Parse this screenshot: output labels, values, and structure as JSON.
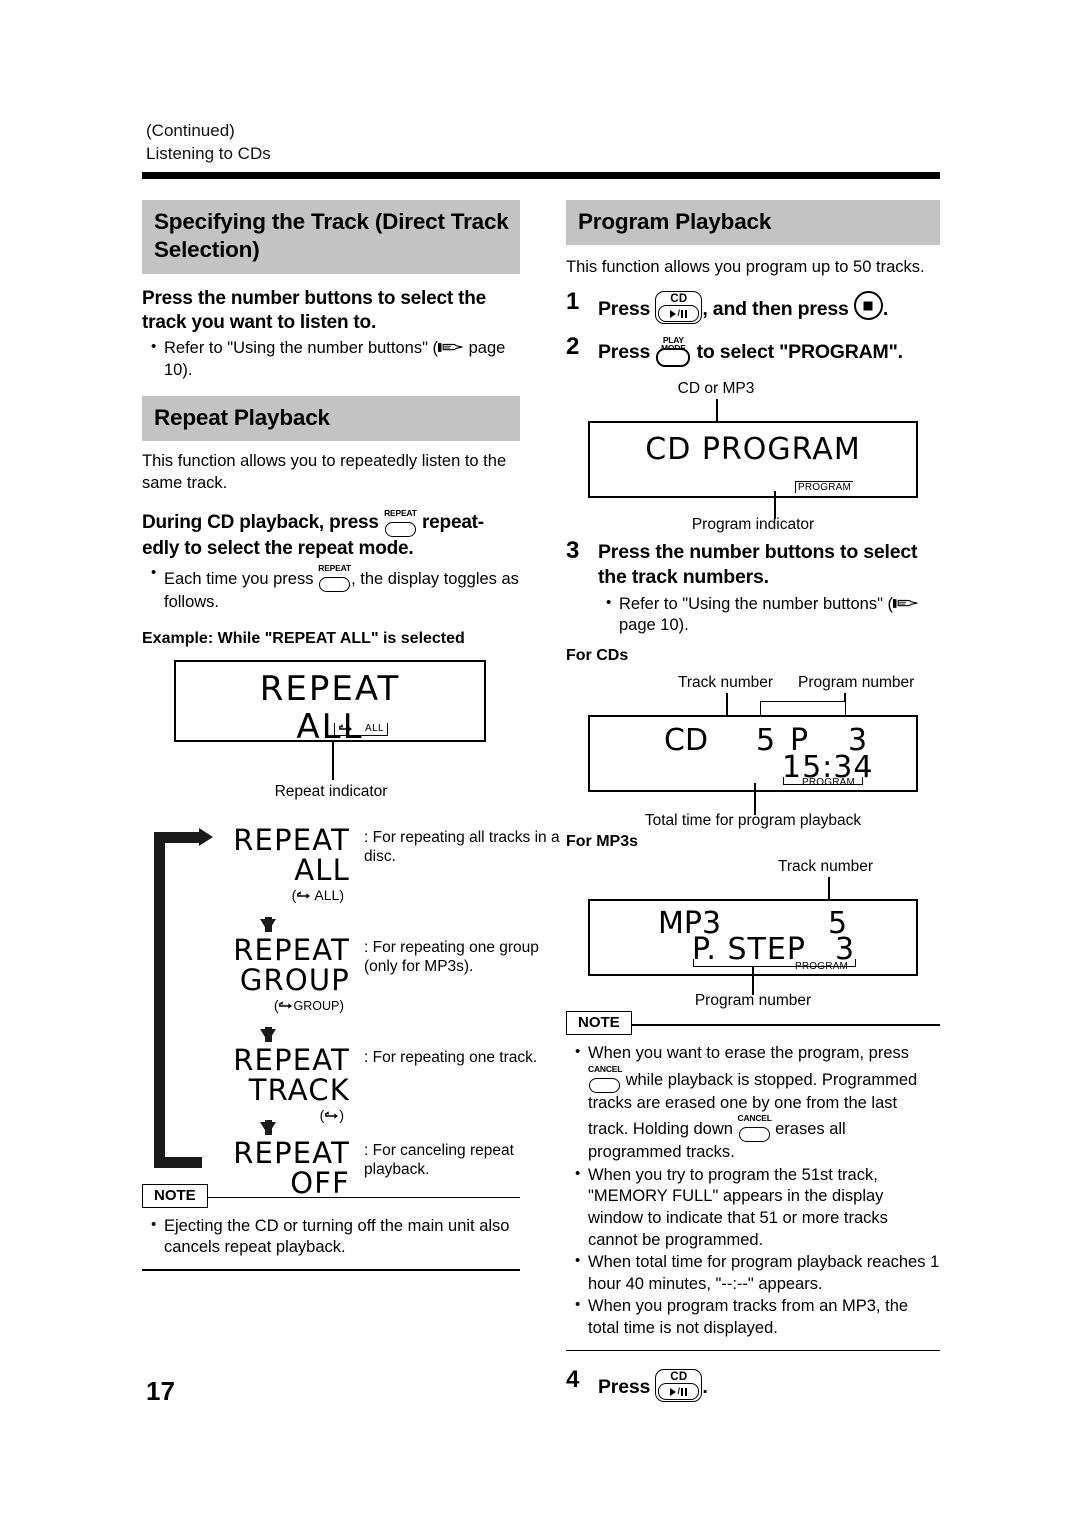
{
  "header": {
    "continued": "(Continued)",
    "running_title": "Listening to CDs"
  },
  "folio": "17",
  "left_column": {
    "section1": {
      "title": "Specifying the Track (Direct Track Selection)",
      "instruction": "Press the number buttons to select the track you want to listen to.",
      "bullets": [
        {
          "pre": "Refer to \"Using the number buttons\" (",
          "icon": "hand-pointer-icon",
          "post": " page 10)."
        }
      ]
    },
    "section2": {
      "title": "Repeat Playback",
      "intro": "This function allows you to repeatedly listen to the same track.",
      "instruction_pre": "During CD playback, press",
      "instruction_button": "REPEAT",
      "instruction_post": "repeat-edly to select the repeat mode.",
      "bullet_pre": "Each time you press",
      "bullet_button": "REPEAT",
      "bullet_post": ", the display toggles as follows.",
      "example_heading": "Example: While \"REPEAT ALL\" is selected",
      "display": {
        "line1": "REPEAT",
        "line2": "ALL",
        "indicator_all": "ALL",
        "indicator_repeat_icon": "repeat-loop-icon"
      },
      "display_caption": "Repeat indicator",
      "flow": [
        {
          "line1": "REPEAT",
          "line2": "ALL",
          "indicator": "( ↺  ALL )",
          "indicator_label": "ALL",
          "desc": ": For repeating all tracks in a disc."
        },
        {
          "line1": "REPEAT",
          "line2": "GROUP",
          "indicator": "( ↺ GROUP )",
          "indicator_label": "GROUP",
          "desc": ": For repeating one group (only for MP3s)."
        },
        {
          "line1": "REPEAT",
          "line2": "TRACK",
          "indicator": "( ↺ )",
          "indicator_label": "",
          "desc": ": For repeating one track."
        },
        {
          "line1": "REPEAT",
          "line2": "OFF",
          "indicator": "",
          "indicator_label": "",
          "desc": ": For canceling repeat playback."
        }
      ],
      "note": {
        "label": "NOTE",
        "items": [
          "Ejecting the CD or turning off the main unit also cancels repeat playback."
        ]
      }
    }
  },
  "right_column": {
    "section": {
      "title": "Program Playback",
      "intro": "This function allows you program up to 50 tracks.",
      "steps": [
        {
          "num": "1",
          "pre": "Press",
          "button1": {
            "top": "CD",
            "glyph": "play-pause-icon"
          },
          "mid": ", and then press",
          "button2": {
            "glyph": "stop-icon"
          },
          "post": "."
        },
        {
          "num": "2",
          "pre": "Press",
          "button1": {
            "top_line1": "PLAY",
            "top_line2": "MODE",
            "glyph": "oval-button-icon"
          },
          "post": "to select \"PROGRAM\"."
        },
        {
          "num": "3",
          "text": "Press the number buttons to select the track numbers.",
          "bullet_pre": "Refer to \"Using the number buttons\" (",
          "bullet_icon": "hand-pointer-icon",
          "bullet_post": " page 10)."
        },
        {
          "num": "4",
          "pre": "Press",
          "button1": {
            "top": "CD",
            "glyph": "play-pause-icon"
          },
          "post": "."
        }
      ],
      "display_program": {
        "top_caption": "CD or MP3",
        "text": "CD  PROGRAM",
        "indicator": "PROGRAM",
        "bottom_caption": "Program indicator"
      },
      "for_cds_heading": "For CDs",
      "display_cd": {
        "caption_track": "Track number",
        "caption_program": "Program number",
        "line1_left": "CD",
        "line1_track": "5",
        "line1_p": "P",
        "line1_prog": "3",
        "line2": "15:34",
        "indicator": "PROGRAM",
        "bottom_caption": "Total time for program playback"
      },
      "for_mp3s_heading": "For MP3s",
      "display_mp3": {
        "caption_track": "Track number",
        "line1_left": "MP3",
        "line1_track": "5",
        "line2_left": "P. STEP",
        "line2_prog": "3",
        "indicator": "PROGRAM",
        "bottom_caption": "Program number"
      },
      "note": {
        "label": "NOTE",
        "item1_pre": "When you want to erase the program, press",
        "item1_button": "CANCEL",
        "item1_mid": "while playback is stopped. Programmed tracks are erased one by one from the last track. Holding down",
        "item1_button2": "CANCEL",
        "item1_post": "erases all programmed tracks.",
        "item2": "When you try to program the 51st track, \"MEMORY FULL\" appears in the display window to indicate that 51 or more tracks cannot be programmed.",
        "item3": "When total time for program playback reaches 1 hour 40 minutes, \"--:--\" appears.",
        "item4": "When you program tracks from an MP3, the total time is not displayed."
      }
    }
  },
  "colors": {
    "section_bar": "#c3c3c3",
    "text": "#000000",
    "page_bg": "#ffffff"
  }
}
